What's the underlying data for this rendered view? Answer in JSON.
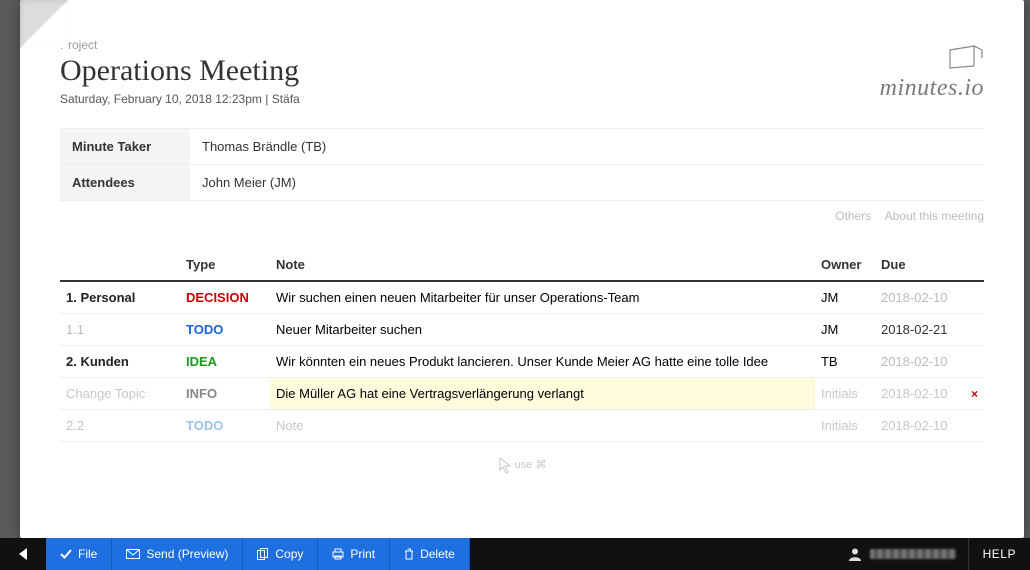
{
  "project_label": "Project",
  "title": "Operations Meeting",
  "subtitle": "Saturday, February 10, 2018 12:23pm | Stäfa",
  "brand": "minutes.io",
  "meta": {
    "minute_taker_label": "Minute Taker",
    "minute_taker_value": "Thomas Brändle (TB)",
    "attendees_label": "Attendees",
    "attendees_value": "John Meier (JM)"
  },
  "meta_links": {
    "others": "Others",
    "about": "About this meeting"
  },
  "columns": {
    "type": "Type",
    "note": "Note",
    "owner": "Owner",
    "due": "Due"
  },
  "rows": [
    {
      "topic": "1. Personal",
      "topic_style": "strong",
      "type": "DECISION",
      "type_class": "type-decision",
      "note": "Wir suchen einen neuen Mitarbeiter für unser Operations-Team",
      "owner": "JM",
      "due": "2018-02-10",
      "due_active": false
    },
    {
      "topic": "1.1",
      "topic_style": "dim",
      "type": "TODO",
      "type_class": "type-todo",
      "note": "Neuer Mitarbeiter suchen",
      "owner": "JM",
      "due": "2018-02-21",
      "due_active": true
    },
    {
      "topic": "2. Kunden",
      "topic_style": "strong",
      "type": "IDEA",
      "type_class": "type-idea",
      "note": "Wir könnten ein neues Produkt lancieren. Unser Kunde Meier AG hatte eine tolle Idee",
      "owner": "TB",
      "due": "2018-02-10",
      "due_active": false
    },
    {
      "topic": "Change Topic",
      "topic_style": "dim",
      "type": "INFO",
      "type_class": "type-info",
      "note": "Die Müller AG hat eine Vertragsverlängerung verlangt",
      "owner": "Initials",
      "due": "2018-02-10",
      "due_active": false,
      "highlight": true,
      "deletable": true
    },
    {
      "topic": "2.2",
      "topic_style": "dim",
      "type": "TODO",
      "type_class": "type-todo",
      "note": "Note",
      "owner": "Initials",
      "due": "2018-02-10",
      "due_active": false,
      "placeholder": true
    }
  ],
  "hint": "use ⌘",
  "toolbar": {
    "file": "File",
    "send": "Send (Preview)",
    "copy": "Copy",
    "print": "Print",
    "delete": "Delete"
  },
  "help": "HELP"
}
